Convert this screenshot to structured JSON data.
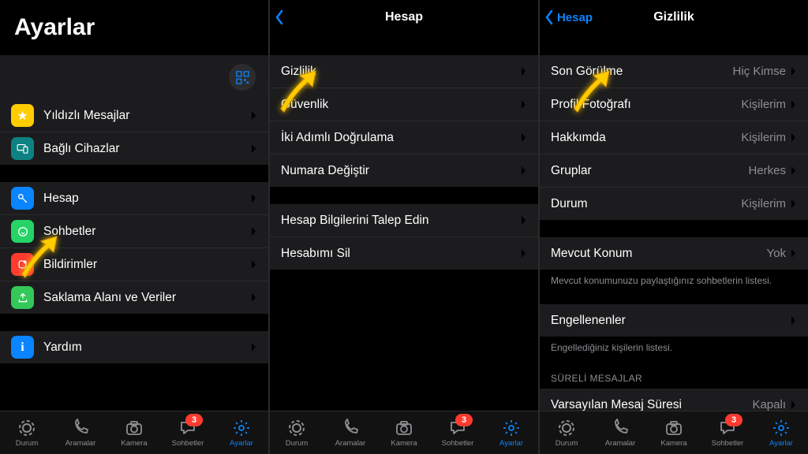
{
  "tabbar": {
    "items": [
      {
        "label": "Durum"
      },
      {
        "label": "Aramalar"
      },
      {
        "label": "Kamera"
      },
      {
        "label": "Sohbetler",
        "badge": "3"
      },
      {
        "label": "Ayarlar"
      }
    ]
  },
  "screen1": {
    "title": "Ayarlar",
    "group_a": [
      {
        "label": "Yıldızlı Mesajlar",
        "icon_bg": "#ffcc00"
      },
      {
        "label": "Bağlı Cihazlar",
        "icon_bg": "#0e8282"
      }
    ],
    "group_b": [
      {
        "label": "Hesap",
        "icon_bg": "#0a84ff"
      },
      {
        "label": "Sohbetler",
        "icon_bg": "#25d366"
      },
      {
        "label": "Bildirimler",
        "icon_bg": "#ff3b30"
      },
      {
        "label": "Saklama Alanı ve Veriler",
        "icon_bg": "#34c759"
      }
    ],
    "group_c": [
      {
        "label": "Yardım",
        "icon_bg": "#0a84ff"
      }
    ]
  },
  "screen2": {
    "title": "Hesap",
    "group_a": [
      {
        "label": "Gizlilik"
      },
      {
        "label": "Güvenlik"
      },
      {
        "label": "İki Adımlı Doğrulama"
      },
      {
        "label": "Numara Değiştir"
      }
    ],
    "group_b": [
      {
        "label": "Hesap Bilgilerini Talep Edin"
      },
      {
        "label": "Hesabımı Sil"
      }
    ]
  },
  "screen3": {
    "back": "Hesap",
    "title": "Gizlilik",
    "group_a": [
      {
        "label": "Son Görülme",
        "value": "Hiç Kimse"
      },
      {
        "label": "Profil Fotoğrafı",
        "value": "Kişilerim"
      },
      {
        "label": "Hakkımda",
        "value": "Kişilerim"
      },
      {
        "label": "Gruplar",
        "value": "Herkes"
      },
      {
        "label": "Durum",
        "value": "Kişilerim"
      }
    ],
    "loc": {
      "label": "Mevcut Konum",
      "value": "Yok",
      "note": "Mevcut konumunuzu paylaştığınız sohbetlerin listesi."
    },
    "blk": {
      "label": "Engellenenler",
      "note": "Engellediğiniz kişilerin listesi."
    },
    "timed_hdr": "SÜRELİ MESAJLAR",
    "timed": {
      "label": "Varsayılan Mesaj Süresi",
      "value": "Kapalı"
    }
  }
}
